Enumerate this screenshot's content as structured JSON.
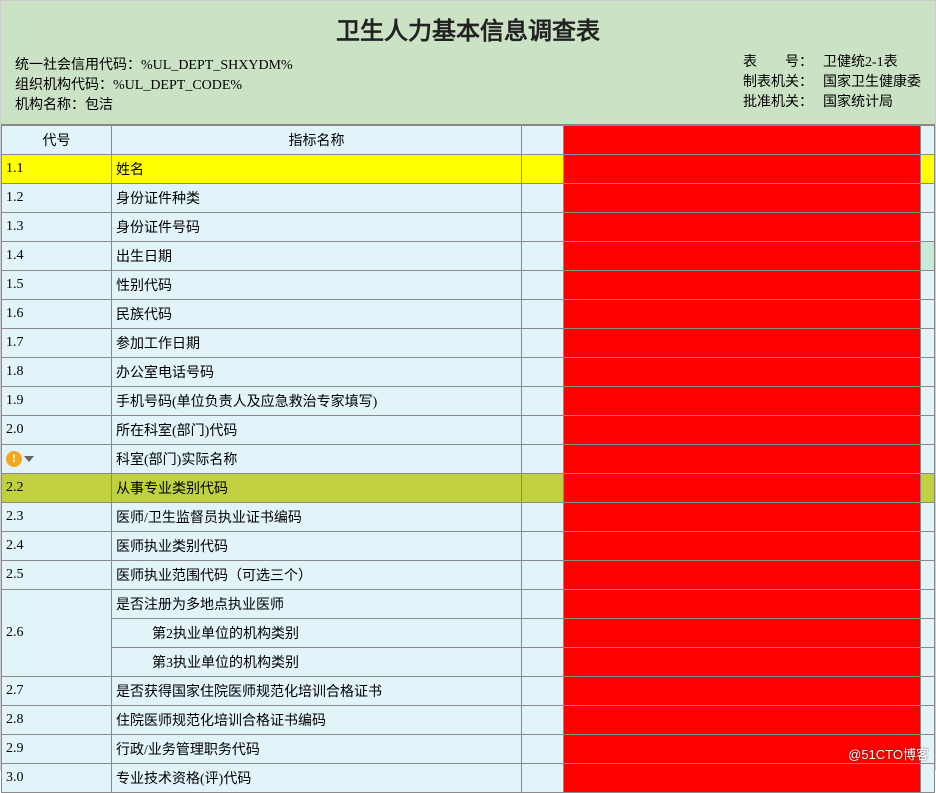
{
  "header": {
    "title": "卫生人力基本信息调查表",
    "left": {
      "line1_label": "统一社会信用代码：",
      "line1_value": "%UL_DEPT_SHXYDM%",
      "line2_label": "组织机构代码：",
      "line2_value": "%UL_DEPT_CODE%",
      "line3_label": "机构名称：",
      "line3_value": "包洁"
    },
    "right": {
      "l1_label": "表　　号：",
      "l1_value": "卫健统2-1表",
      "l2_label": "制表机关：",
      "l2_value": "国家卫生健康委",
      "l3_label": "批准机关：",
      "l3_value": "国家统计局"
    }
  },
  "columns": {
    "code": "代号",
    "name": "指标名称"
  },
  "rows": [
    {
      "code": "1.1",
      "name": "姓名",
      "hl": "yellow"
    },
    {
      "code": "1.2",
      "name": "身份证件种类"
    },
    {
      "code": "1.3",
      "name": "身份证件号码"
    },
    {
      "code": "1.4",
      "name": "出生日期",
      "dateTail": true
    },
    {
      "code": "1.5",
      "name": "性别代码"
    },
    {
      "code": "1.6",
      "name": "民族代码"
    },
    {
      "code": "1.7",
      "name": "参加工作日期"
    },
    {
      "code": "1.8",
      "name": "办公室电话号码"
    },
    {
      "code": "1.9",
      "name": "手机号码(单位负责人及应急救治专家填写)"
    },
    {
      "code": "2.0",
      "name": "所在科室(部门)代码"
    },
    {
      "code": "",
      "name": "科室(部门)实际名称",
      "warn": true
    },
    {
      "code": "2.2",
      "name": "从事专业类别代码",
      "hl": "lime"
    },
    {
      "code": "2.3",
      "name": "医师/卫生监督员执业证书编码"
    },
    {
      "code": "2.4",
      "name": "医师执业类别代码"
    },
    {
      "code": "2.5",
      "name": "医师执业范围代码（可选三个）"
    },
    {
      "code": "",
      "name": "是否注册为多地点执业医师",
      "groupStart": "2.6"
    },
    {
      "code": "2.6",
      "name": "第2执业单位的机构类别",
      "indent": true,
      "groupMid": true
    },
    {
      "code": "",
      "name": "第3执业单位的机构类别",
      "indent": true,
      "groupEnd": true
    },
    {
      "code": "2.7",
      "name": "是否获得国家住院医师规范化培训合格证书"
    },
    {
      "code": "2.8",
      "name": "住院医师规范化培训合格证书编码"
    },
    {
      "code": "2.9",
      "name": "行政/业务管理职务代码"
    },
    {
      "code": "3.0",
      "name": "专业技术资格(评)代码"
    }
  ],
  "watermark": "@51CTO博客"
}
